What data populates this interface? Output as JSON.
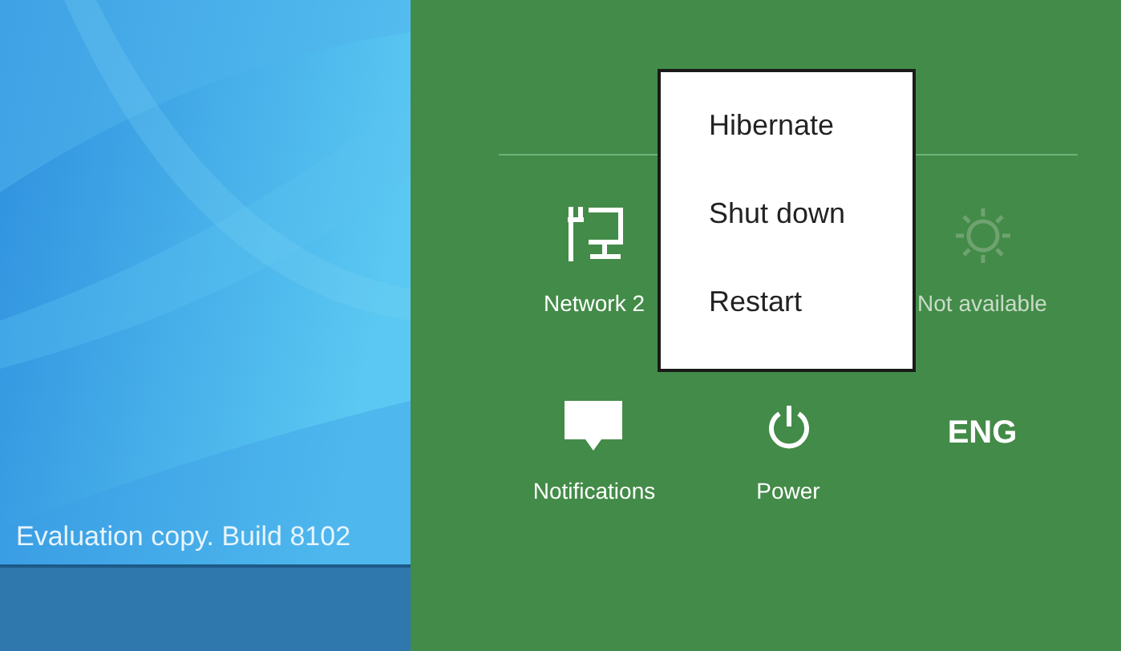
{
  "desktop": {
    "watermark_text": "Evaluation copy. Build 8102"
  },
  "settings": {
    "tiles": [
      {
        "kind": "network",
        "label": "Network 2"
      },
      {
        "kind": "brightness",
        "label": "Not available",
        "disabled": true
      },
      {
        "kind": "notifications",
        "label": "Notifications"
      },
      {
        "kind": "power",
        "label": "Power"
      },
      {
        "kind": "language",
        "text": "ENG"
      }
    ]
  },
  "power_menu": {
    "items": [
      {
        "label": "Hibernate"
      },
      {
        "label": "Shut down"
      },
      {
        "label": "Restart"
      }
    ]
  }
}
